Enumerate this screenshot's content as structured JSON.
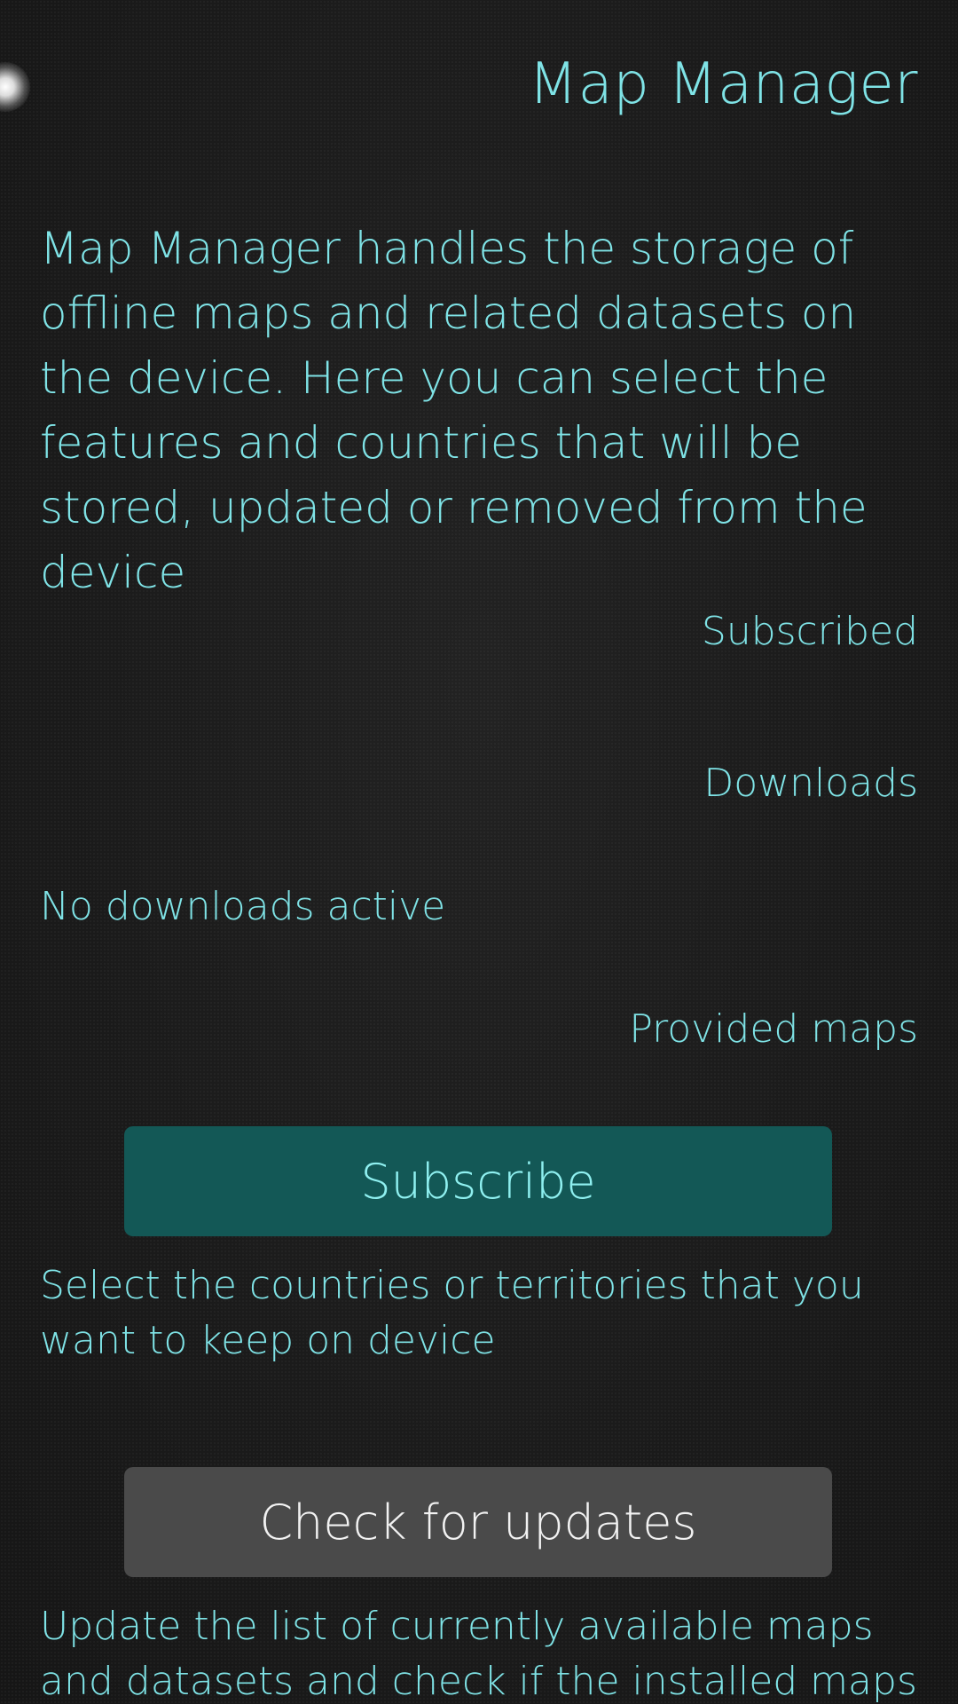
{
  "colors": {
    "accent": "#7fe3e6",
    "background": "#1b1b1b",
    "subscribe_button_bg": "#135856",
    "updates_button_bg": "#4a4a4a"
  },
  "header": {
    "title": "Map Manager",
    "pulley_indicator_icon": "pulley-menu-glow"
  },
  "intro": {
    "text": "Map Manager handles the storage of offline maps and related datasets on the device. Here you can select the features and countries that will be stored, updated or removed from the device"
  },
  "sections": {
    "subscribed": {
      "label": "Subscribed"
    },
    "downloads": {
      "label": "Downloads",
      "status": "No downloads active"
    },
    "provided": {
      "label": "Provided maps"
    }
  },
  "subscribe": {
    "button_label": "Subscribe",
    "hint": "Select the countries or territories that you want to keep on device"
  },
  "updates": {
    "button_label": "Check for updates",
    "hint": "Update the list of currently available maps and datasets and check if the installed maps can be"
  }
}
